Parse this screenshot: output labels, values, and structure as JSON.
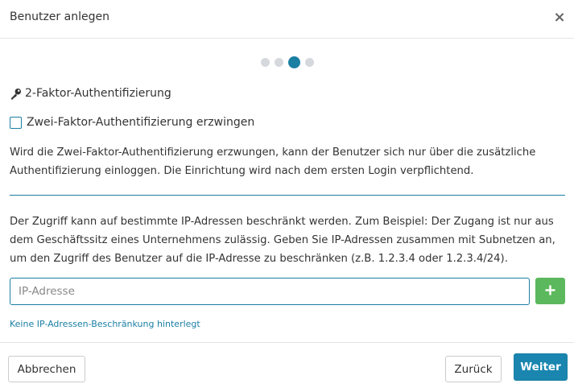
{
  "header": {
    "title": "Benutzer anlegen",
    "close_label": "×"
  },
  "steps": {
    "total": 4,
    "current": 3
  },
  "section": {
    "title": "2-Faktor-Authentifizierung",
    "icon": "key-icon"
  },
  "checkbox": {
    "label": "Zwei-Faktor-Authentifizierung erzwingen",
    "checked": false
  },
  "paragraph_2fa": "Wird die Zwei-Faktor-Authentifizierung erzwungen, kann der Benutzer sich nur über die zusätzliche Authentifizierung einloggen. Die Einrichtung wird nach dem ersten Login verpflichtend.",
  "paragraph_ip": "Der Zugriff kann auf bestimmte IP-Adressen beschränkt werden. Zum Beispiel: Der Zugang ist nur aus dem Geschäftssitz eines Unternehmens zulässig. Geben Sie IP-Adressen zusammen mit Subnetzen an, um den Zugriff des Benutzer auf die IP-Adresse zu beschränken (z.B. 1.2.3.4 oder 1.2.3.4/24).",
  "ip_input": {
    "placeholder": "IP-Adresse",
    "value": ""
  },
  "add_button": {
    "icon": "plus-icon"
  },
  "status_text": "Keine IP-Adressen-Beschränkung hinterlegt",
  "footer": {
    "cancel_label": "Abbrechen",
    "back_label": "Zurück",
    "next_label": "Weiter"
  },
  "colors": {
    "accent": "#1a7fa3",
    "primary_button": "#1a86b0",
    "add_button": "#5cb85c",
    "step_inactive": "#d5d8dc"
  }
}
